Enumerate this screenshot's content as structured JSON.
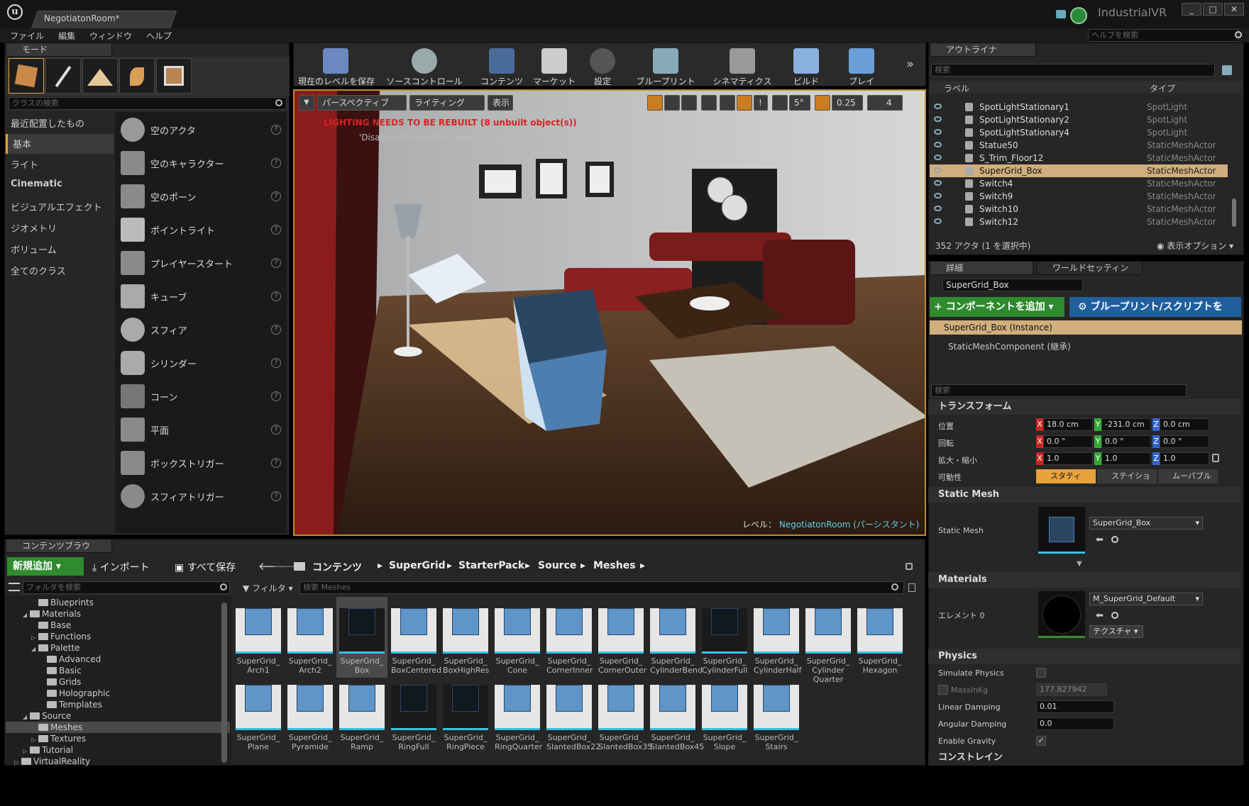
{
  "window": {
    "doc_tab": "NegotiatonRoom*",
    "project": "IndustrialVR",
    "controls": [
      "_",
      "□",
      "✕"
    ]
  },
  "menu": [
    "ファイル",
    "編集",
    "ウィンドウ",
    "ヘルプ"
  ],
  "help_search_placeholder": "ヘルプを検索",
  "modes": {
    "tab": "モード",
    "search_placeholder": "クラスの検索",
    "categories": [
      "最近配置したもの",
      "基本",
      "ライト",
      "Cinematic",
      "ビジュアルエフェクト",
      "ジオメトリ",
      "ボリューム",
      "全てのクラス"
    ],
    "selected_category": "基本",
    "actors": [
      "空のアクタ",
      "空のキャラクター",
      "空のポーン",
      "ポイントライト",
      "プレイヤースタート",
      "キューブ",
      "スフィア",
      "シリンダー",
      "コーン",
      "平面",
      "ボックストリガー",
      "スフィアトリガー"
    ]
  },
  "toolbar": [
    "現在のレベルを保存",
    "ソースコントロール",
    "コンテンツ",
    "マーケット",
    "設定",
    "ブループリント",
    "シネマティクス",
    "ビルド",
    "プレイ"
  ],
  "viewport": {
    "perspective": "パースペクティブ",
    "lighting": "ライティング",
    "show": "表示",
    "warning": "LIGHTING NEEDS TO BE REBUILT (8 unbuilt object(s))",
    "suppress_hint": "'DisableAllScreenMessages' to suppress",
    "snap_angle": "5°",
    "snap_scale": "0.25",
    "camera_speed": "4",
    "level_label": "レベル：",
    "level_name": "NegotiatonRoom (パーシスタント)"
  },
  "outliner": {
    "tab": "アウトライナ",
    "search_placeholder": "検索",
    "col_label": "ラベル",
    "col_type": "タイプ",
    "rows": [
      {
        "name": "SpotLightStationary1",
        "type": "SpotLight"
      },
      {
        "name": "SpotLightStationary2",
        "type": "SpotLight"
      },
      {
        "name": "SpotLightStationary4",
        "type": "SpotLight"
      },
      {
        "name": "Statue50",
        "type": "StaticMeshActor"
      },
      {
        "name": "S_Trim_Floor12",
        "type": "StaticMeshActor"
      },
      {
        "name": "SuperGrid_Box",
        "type": "StaticMeshActor"
      },
      {
        "name": "Switch4",
        "type": "StaticMeshActor"
      },
      {
        "name": "Switch9",
        "type": "StaticMeshActor"
      },
      {
        "name": "Switch10",
        "type": "StaticMeshActor"
      },
      {
        "name": "Switch12",
        "type": "StaticMeshActor"
      }
    ],
    "selected": "SuperGrid_Box",
    "count": "352 アクタ (1 を選択中)",
    "view_options": "表示オプション"
  },
  "details": {
    "tab": "詳細",
    "tab2": "ワールドセッティン",
    "object_name": "SuperGrid_Box",
    "add_component": "+ コンポーネントを追加",
    "blueprint_btn": "ブループリント/スクリプトを",
    "instance": "SuperGrid_Box (Instance)",
    "component": "StaticMeshComponent (継承)",
    "search_placeholder": "検索",
    "transform": {
      "header": "トランスフォーム",
      "location_label": "位置",
      "rotation_label": "回転",
      "scale_label": "拡大・縮小",
      "mobility_label": "可動性",
      "location": [
        "18.0 cm",
        "-231.0 cm",
        "0.0 cm"
      ],
      "rotation": [
        "0.0 °",
        "0.0 °",
        "0.0 °"
      ],
      "scale": [
        "1.0",
        "1.0",
        "1.0"
      ],
      "mobility": [
        "スタティ",
        "ステイショ",
        "ムーバブル"
      ]
    },
    "static_mesh": {
      "header": "Static Mesh",
      "label": "Static Mesh",
      "value": "SuperGrid_Box"
    },
    "materials": {
      "header": "Materials",
      "label": "エレメント 0",
      "value": "M_SuperGrid_Default",
      "textures_btn": "テクスチャ"
    },
    "physics": {
      "header": "Physics",
      "simulate": "Simulate Physics",
      "mass": "MassInKg",
      "mass_value": "177.827942",
      "linear": "Linear Damping",
      "linear_value": "0.01",
      "angular": "Angular Damping",
      "angular_value": "0.0",
      "gravity": "Enable Gravity"
    },
    "constraints": "コンストレイン"
  },
  "content_browser": {
    "tab": "コンテンツブラウ",
    "add_new": "新規追加",
    "import": "インポート",
    "save_all": "すべて保存",
    "breadcrumb": [
      "コンテンツ",
      "SuperGrid",
      "StarterPack",
      "Source",
      "Meshes"
    ],
    "folder_search_placeholder": "フォルダを検索",
    "filter": "フィルタ",
    "asset_search_placeholder": "検索 Meshes",
    "tree": [
      {
        "label": "Blueprints",
        "indent": 3
      },
      {
        "label": "Materials",
        "indent": 2,
        "arrow": "◢"
      },
      {
        "label": "Base",
        "indent": 3
      },
      {
        "label": "Functions",
        "indent": 3,
        "arrow": "▷"
      },
      {
        "label": "Palette",
        "indent": 3,
        "arrow": "◢"
      },
      {
        "label": "Advanced",
        "indent": 4
      },
      {
        "label": "Basic",
        "indent": 4
      },
      {
        "label": "Grids",
        "indent": 4
      },
      {
        "label": "Holographic",
        "indent": 4
      },
      {
        "label": "Templates",
        "indent": 4
      },
      {
        "label": "Source",
        "indent": 2,
        "arrow": "◢"
      },
      {
        "label": "Meshes",
        "indent": 3,
        "selected": true
      },
      {
        "label": "Textures",
        "indent": 3,
        "arrow": "▷"
      },
      {
        "label": "Tutorial",
        "indent": 2,
        "arrow": "▷"
      },
      {
        "label": "VirtualReality",
        "indent": 1,
        "arrow": "▷"
      }
    ],
    "assets_row1": [
      "SuperGrid_\nArch1",
      "SuperGrid_\nArch2",
      "SuperGrid_\nBox",
      "SuperGrid_\nBoxCentered",
      "SuperGrid_\nBoxHighRes",
      "SuperGrid_\nCone",
      "SuperGrid_\nCornerInner",
      "SuperGrid_\nCornerOuter",
      "SuperGrid_\nCylinderBend",
      "SuperGrid_\nCylinderFull",
      "SuperGrid_\nCylinderHalf",
      "SuperGrid_\nCylinder\nQuarter",
      "SuperGrid_\nHexagon"
    ],
    "assets_row2": [
      "SuperGrid_\nPlane",
      "SuperGrid_\nPyramide",
      "SuperGrid_\nRamp",
      "SuperGrid_\nRingFull",
      "SuperGrid_\nRingPiece",
      "SuperGrid_\nRingQuarter",
      "SuperGrid_\nSlantedBox22",
      "SuperGrid_\nSlantedBox35",
      "SuperGrid_\nSlantedBox45",
      "SuperGrid_\nSlope",
      "SuperGrid_\nStairs"
    ],
    "selected_asset": "SuperGrid_\nBox"
  },
  "colors": {
    "accent": "#e8a23a",
    "selection": "#d0ae7d",
    "add_green": "#2e8b2e",
    "blueprint_blue": "#1f5f9e",
    "warning_red": "#d22"
  }
}
